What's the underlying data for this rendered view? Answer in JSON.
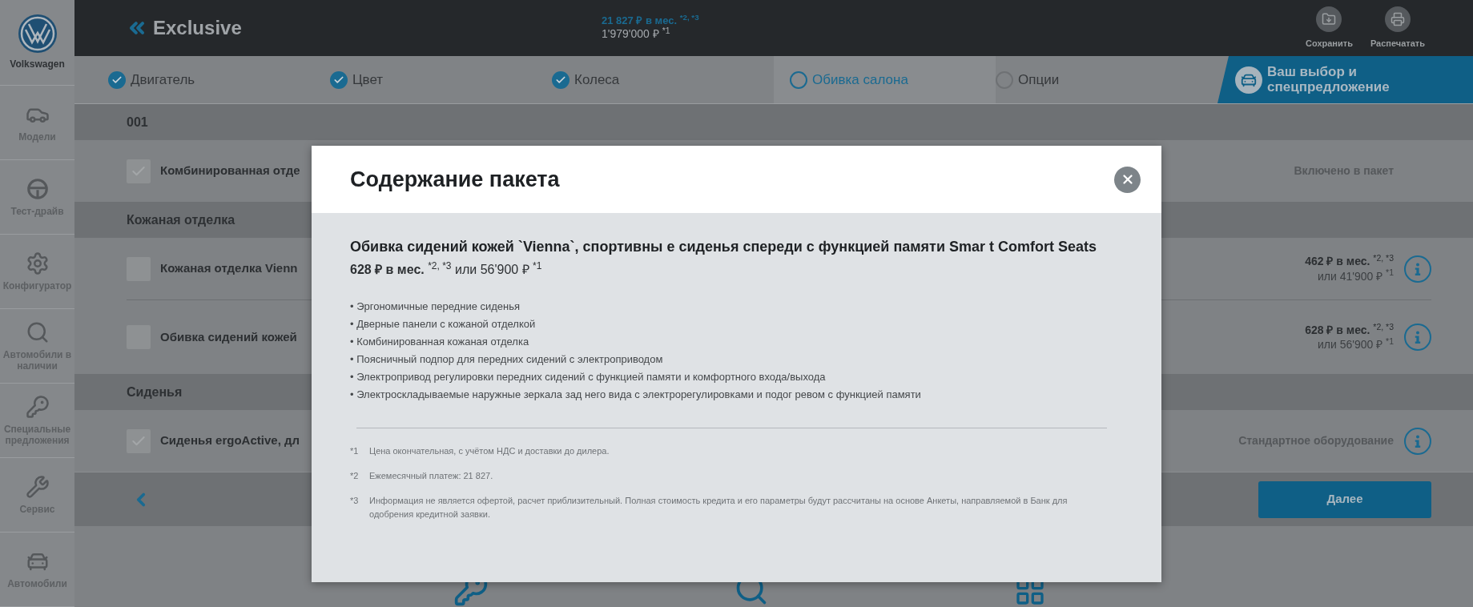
{
  "brand": {
    "name": "Volkswagen"
  },
  "sidebar": {
    "items": [
      {
        "label": "Модели"
      },
      {
        "label": "Тест-драйв"
      },
      {
        "label": "Конфигуратор"
      },
      {
        "label": "Автомобили в наличии"
      },
      {
        "label": "Специальные предложения"
      },
      {
        "label": "Сервис"
      },
      {
        "label": "Автомобили"
      }
    ]
  },
  "header": {
    "title": "Exclusive",
    "monthly": "21 827 ₽ в мес. $^{*2, *3}$",
    "total": "1'979'000 ₽ $^{*1}$",
    "actions": [
      {
        "label": "Сохранить"
      },
      {
        "label": "Распечатать"
      }
    ]
  },
  "steps": [
    {
      "label": "Двигатель",
      "kind": "step",
      "completed": true,
      "selected": false
    },
    {
      "label": "Цвет",
      "kind": "step",
      "completed": true,
      "selected": false
    },
    {
      "label": "Колеса",
      "kind": "step",
      "completed": true,
      "selected": false
    },
    {
      "label": "Обивка салона",
      "kind": "step",
      "completed": false,
      "selected": true
    },
    {
      "label": "Опции",
      "kind": "step",
      "completed": false,
      "selected": false
    },
    {
      "label": "Ваш выбор и спецпредложение",
      "kind": "summary"
    }
  ],
  "sections": [
    {
      "title": "001",
      "options": [
        {
          "label": "Комбинированная отде",
          "checked": true,
          "kind": "note",
          "note": "Включено в пакет",
          "info": false
        }
      ]
    },
    {
      "title": "Кожаная отделка",
      "options": [
        {
          "label": "Кожаная отделка Vienn",
          "checked": false,
          "kind": "price",
          "monthly": "**462 ₽ в мес.** $^{*2, *3}$",
          "total": "или 41'900 ₽ $^{*1}$",
          "info": true
        },
        {
          "label": "Обивка сидений кожей",
          "checked": false,
          "kind": "price",
          "monthly": "**628 ₽ в мес.** $^{*2, *3}$",
          "total": "или 56'900 ₽ $^{*1}$",
          "info": true
        }
      ]
    },
    {
      "title": "Сиденья",
      "options": [
        {
          "label": "Сиденья ergoActive, дл",
          "checked": true,
          "kind": "note",
          "note": "Стандартное оборудование",
          "info": true
        }
      ]
    }
  ],
  "nav": {
    "next": "Далее"
  },
  "modal": {
    "title": "Содержание пакета",
    "heading": "Обивка сидений кожей `Vienna`, спортивны е сиденья спереди с функцией памяти Smar t Comfort Seats",
    "price": "**628 ₽ в мес.** $^{*2, *3}$ или 56'900 ₽ $^{*1}$",
    "bullets": [
      "• Эргономичные передние сиденья",
      "• Дверные панели с кожаной отделкой",
      "• Комбинированная кожаная отделка",
      "• Поясничный подпор для передних сидений с электроприводом",
      "• Электропривод регулировки передних сидений с функцией памяти и комфортного входа/выхода",
      "• Электроскладываемые наружные зеркала зад него вида с электрорегулировками и подог ревом с функцией памяти"
    ],
    "footnotes": [
      {
        "mark": "*1",
        "text": "Цена окончательная, с учётом НДС и доставки до дилера."
      },
      {
        "mark": "*2",
        "text": "Ежемесячный платеж: 21 827."
      },
      {
        "mark": "*3",
        "text": "Информация не является офертой, расчет приблизительный. Полная стоимость кредита и его параметры будут рассчитаны на основе Анкеты, направляемой в Банк для одобрения кредитной заявки."
      }
    ]
  }
}
